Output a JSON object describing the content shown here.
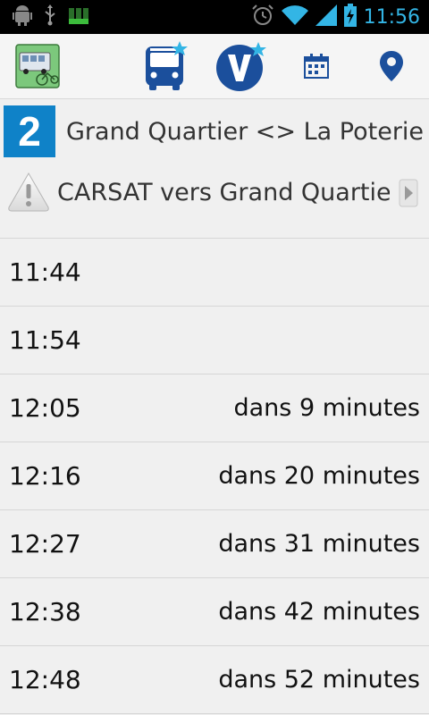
{
  "status_bar": {
    "time": "11:56",
    "icons": [
      "android-debug-icon",
      "usb-icon",
      "signal-bars-icon",
      "alarm-icon",
      "wifi-icon",
      "cell-signal-icon",
      "battery-charging-icon"
    ]
  },
  "action_bar": {
    "icons": [
      "app-logo-bus-icon",
      "bus-favorite-icon",
      "velo-favorite-icon",
      "calendar-icon",
      "location-pin-icon"
    ]
  },
  "route": {
    "number": "2",
    "name": "Grand Quartier <> La Poterie /",
    "color": "#0f82c8"
  },
  "direction": {
    "label": "CARSAT vers Grand Quartie"
  },
  "departures": [
    {
      "time": "11:44",
      "delta": ""
    },
    {
      "time": "11:54",
      "delta": ""
    },
    {
      "time": "12:05",
      "delta": "dans 9 minutes"
    },
    {
      "time": "12:16",
      "delta": "dans 20 minutes"
    },
    {
      "time": "12:27",
      "delta": "dans 31 minutes"
    },
    {
      "time": "12:38",
      "delta": "dans 42 minutes"
    },
    {
      "time": "12:48",
      "delta": "dans 52 minutes"
    }
  ]
}
